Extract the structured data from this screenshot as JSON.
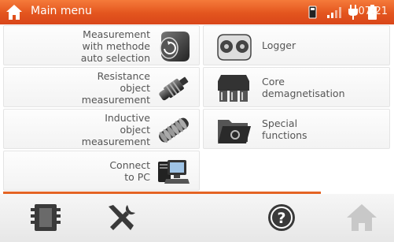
{
  "header": {
    "title": "Main menu",
    "time": "07:21",
    "accent_color": "#e3551e",
    "status_icons": [
      "memory-card-icon",
      "signal-bars-icon",
      "power-plug-icon",
      "battery-icon"
    ]
  },
  "menu": {
    "left": [
      {
        "label_lines": [
          "Measurement",
          "with methode",
          "auto selection"
        ],
        "icon": "auto-selection-icon"
      },
      {
        "label_lines": [
          "Resistance",
          "object",
          "measurement"
        ],
        "icon": "resistance-probe-icon"
      },
      {
        "label_lines": [
          "Inductive",
          "object",
          "measurement"
        ],
        "icon": "inductive-coil-icon"
      },
      {
        "label_lines": [
          "Connect",
          "to PC"
        ],
        "icon": "pc-connection-icon"
      }
    ],
    "right": [
      {
        "label_lines": [
          "Logger"
        ],
        "icon": "logger-tape-icon"
      },
      {
        "label_lines": [
          "Core",
          "demagnetisation"
        ],
        "icon": "core-demagnetisation-icon"
      },
      {
        "label_lines": [
          "Special",
          "functions"
        ],
        "icon": "special-functions-folder-icon"
      }
    ]
  },
  "progress": {
    "fraction": 0.82,
    "color": "#e46424"
  },
  "toolbar": {
    "buttons": [
      "memory-icon",
      "settings-tools-icon",
      "help-icon",
      "home-icon"
    ]
  }
}
